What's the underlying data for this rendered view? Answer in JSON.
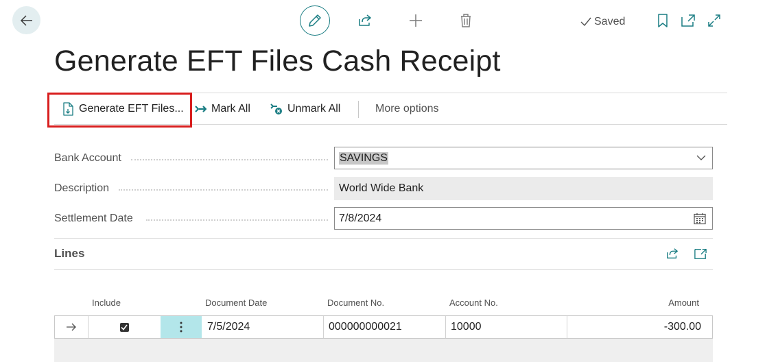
{
  "header": {
    "title": "Generate EFT Files Cash Receipt",
    "saved_label": "Saved"
  },
  "actions": {
    "generate_eft": "Generate EFT Files...",
    "mark_all": "Mark All",
    "unmark_all": "Unmark All",
    "more_options": "More options"
  },
  "fields": {
    "bank_account": {
      "label": "Bank Account",
      "value": "SAVINGS"
    },
    "description": {
      "label": "Description",
      "value": "World Wide Bank"
    },
    "settlement_date": {
      "label": "Settlement Date",
      "value": "7/8/2024"
    }
  },
  "lines": {
    "title": "Lines",
    "columns": [
      "Include",
      "Document Date",
      "Document No.",
      "Account No.",
      "Amount"
    ],
    "rows": [
      {
        "include": true,
        "document_date": "7/5/2024",
        "document_no": "000000000021",
        "account_no": "10000",
        "amount": "-300.00"
      }
    ]
  },
  "colors": {
    "accent": "#1a7d83",
    "highlight": "#d81e1e",
    "selected_cell": "#b3e6ea"
  },
  "icons": [
    "back-arrow-icon",
    "pencil-icon",
    "share-icon",
    "plus-icon",
    "trash-icon",
    "checkmark-icon",
    "bookmark-icon",
    "open-new-window-icon",
    "expand-icon",
    "document-icon",
    "arrow-right-icon",
    "unmark-icon",
    "chevron-down-icon",
    "calendar-icon",
    "row-arrow-icon",
    "ellipsis-vertical-icon",
    "checkbox-icon"
  ]
}
